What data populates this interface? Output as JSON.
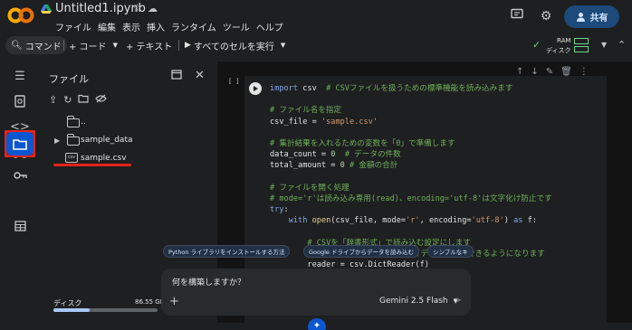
{
  "header": {
    "title": "Untitled1.ipynb",
    "menu": [
      "ファイル",
      "編集",
      "表示",
      "挿入",
      "ランタイム",
      "ツール",
      "ヘルプ"
    ],
    "share_label": "共有",
    "logo_colors": [
      "#f9ab00",
      "#e8710a"
    ],
    "icons": [
      "star-icon",
      "cloud-icon",
      "comment-icon",
      "gear-icon",
      "person-icon"
    ]
  },
  "toolbar": {
    "command_label": "コマンド",
    "code_label": "+ コード",
    "text_label": "+ テキスト",
    "run_all_label": "すべてのセルを実行",
    "ram_label": "RAM",
    "disk_label": "ディスク",
    "status_color": "#6dd58c"
  },
  "rail": {
    "icons": [
      "toc-icon",
      "find-icon",
      "code-snippets-icon",
      "variables-icon",
      "secrets-key-icon",
      "folder-icon",
      "terminal-table-icon"
    ],
    "active": "folder-icon",
    "highlight_color": "#e3241b"
  },
  "files": {
    "title": "ファイル",
    "items": [
      {
        "name": "..",
        "type": "folder"
      },
      {
        "name": "sample_data",
        "type": "folder"
      },
      {
        "name": "sample.csv",
        "type": "csv"
      }
    ],
    "disk_label": "ディスク",
    "disk_size": "86.55 GB"
  },
  "cell": {
    "exec_count": "[ ]",
    "lines": [
      "import csv  # CSVファイルを扱うための標準機能を読み込みます",
      "",
      "# ファイル名を指定",
      "csv_file = 'sample.csv'",
      "",
      "# 集計結果を入れるための変数を「0」で準備します",
      "data_count = 0  # データの件数",
      "total_amount = 0 # 金額の合計",
      "",
      "# ファイルを開く処理",
      "# mode='r'は読み込み専用(read)、encoding='utf-8'は文字化け防止です",
      "try:",
      "    with open(csv_file, mode='r', encoding='utf-8') as f:",
      "",
      "        # CSVを「辞書形式」で読み込む設定にします",
      "        …列の名前（ヘッダー）を使ってデータを指定できるようになります",
      "        reader = csv.DictReader(f)"
    ]
  },
  "suggestions": [
    "Python ライブラリをインストールする方法",
    "Google ドライブからデータを読み込む",
    "シンプルなキ"
  ],
  "ai_input": {
    "placeholder": "何を構築しますか？",
    "model": "Gemini 2.5 Flash"
  }
}
